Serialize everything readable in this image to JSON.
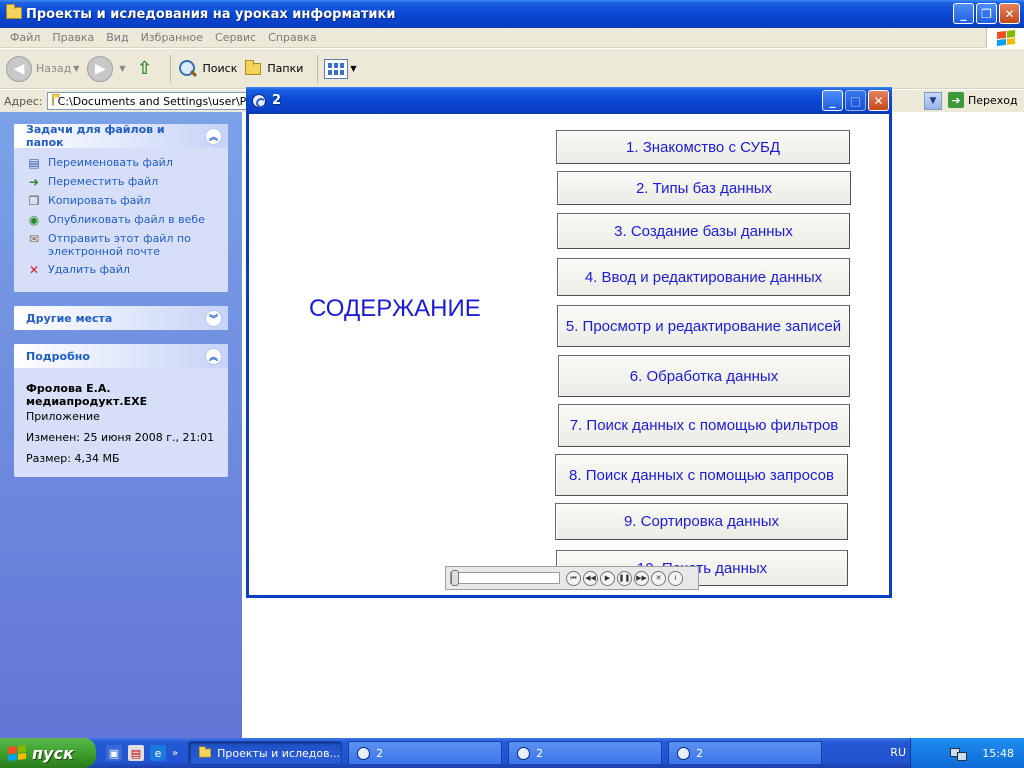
{
  "window": {
    "title": "Проекты и иследования на уроках информатики"
  },
  "menubar": [
    "Файл",
    "Правка",
    "Вид",
    "Избранное",
    "Сервис",
    "Справка"
  ],
  "toolbar": {
    "back": "Назад",
    "search": "Поиск",
    "folders": "Папки"
  },
  "address": {
    "label": "Адрес:",
    "value": "C:\\Documents and Settings\\user\\Раб",
    "go": "Переход"
  },
  "taskpane": {
    "file_tasks": {
      "title": "Задачи для файлов и папок",
      "items": [
        {
          "label": "Переименовать файл",
          "icon": "rename-icon"
        },
        {
          "label": "Переместить файл",
          "icon": "move-icon"
        },
        {
          "label": "Копировать файл",
          "icon": "copy-icon"
        },
        {
          "label": "Опубликовать файл в вебе",
          "icon": "publish-web-icon"
        },
        {
          "label": "Отправить этот файл по электронной почте",
          "icon": "email-icon"
        },
        {
          "label": "Удалить файл",
          "icon": "delete-icon"
        }
      ]
    },
    "other_places": {
      "title": "Другие места"
    },
    "details": {
      "title": "Подробно",
      "name_line1": "Фролова Е.А.",
      "name_line2": "медиапродукт.EXE",
      "type": "Приложение",
      "modified": "Изменен: 25 июня 2008 г., 21:01",
      "size": "Размер: 4,34 МБ"
    }
  },
  "popup": {
    "title": "2",
    "heading": "СОДЕРЖАНИЕ",
    "menu": [
      "1. Знакомство с СУБД",
      "2. Типы баз данных",
      "3. Создание базы данных",
      "4. Ввод и редактирование данных",
      "5. Просмотр и редактирование записей",
      "6. Обработка данных",
      "7. Поиск данных с помощью фильтров",
      "8. Поиск данных с помощью запросов",
      "9. Сортировка данных",
      "10. Печать данных"
    ]
  },
  "taskbar": {
    "start": "пуск",
    "tasks": [
      {
        "label": "Проекты и иследов...",
        "active": true
      },
      {
        "label": "2",
        "active": false
      },
      {
        "label": "2",
        "active": false
      },
      {
        "label": "2",
        "active": false
      }
    ],
    "lang": "RU",
    "clock": "15:48"
  },
  "colors": {
    "xp_blue": "#0a48d4",
    "link_blue": "#215dc6",
    "menu_text": "#1c1cd8",
    "start_green": "#3a9a2a"
  }
}
